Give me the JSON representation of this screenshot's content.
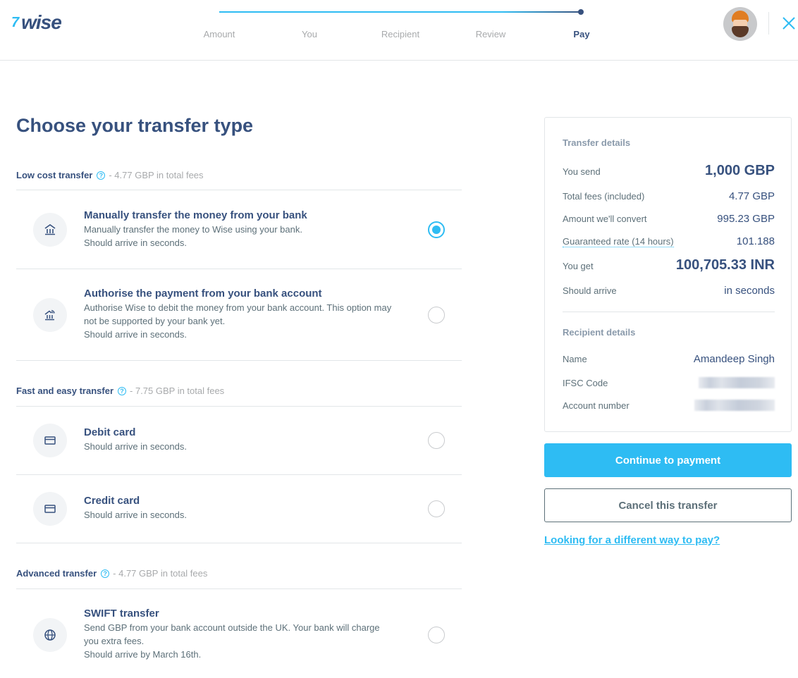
{
  "header": {
    "logo_flag": "7",
    "logo_word": "wise",
    "steps": [
      {
        "label": "Amount",
        "state": "done"
      },
      {
        "label": "You",
        "state": "done"
      },
      {
        "label": "Recipient",
        "state": "done"
      },
      {
        "label": "Review",
        "state": "done"
      },
      {
        "label": "Pay",
        "state": "active"
      }
    ],
    "avatar_icon": "user-avatar",
    "close_icon": "close-icon"
  },
  "main": {
    "title": "Choose your transfer type",
    "sections": [
      {
        "name": "Low cost transfer",
        "help": "?",
        "fee": "- 4.77 GBP in total fees",
        "options": [
          {
            "title": "Manually transfer the money from your bank",
            "desc": [
              "Manually transfer the money to Wise using your bank.",
              "Should arrive in seconds."
            ],
            "icon": "bank-icon",
            "selected": true
          },
          {
            "title": "Authorise the payment from your bank account",
            "desc": [
              "Authorise Wise to debit the money from your bank account. This option may not be supported by your bank yet.",
              "Should arrive in seconds."
            ],
            "icon": "bank-wireless-icon",
            "selected": false
          }
        ]
      },
      {
        "name": "Fast and easy transfer",
        "help": "?",
        "fee": "- 7.75 GBP in total fees",
        "options": [
          {
            "title": "Debit card",
            "desc": [
              "Should arrive in seconds."
            ],
            "icon": "card-icon",
            "selected": false
          },
          {
            "title": "Credit card",
            "desc": [
              "Should arrive in seconds."
            ],
            "icon": "card-icon",
            "selected": false
          }
        ]
      },
      {
        "name": "Advanced transfer",
        "help": "?",
        "fee": "- 4.77 GBP in total fees",
        "options": [
          {
            "title": "SWIFT transfer",
            "desc": [
              "Send GBP from your bank account outside the UK. Your bank will charge you extra fees.",
              "Should arrive by March 16th."
            ],
            "icon": "globe-icon",
            "selected": false
          }
        ]
      }
    ]
  },
  "summary": {
    "transfer_label": "Transfer details",
    "rows": [
      {
        "k": "You send",
        "v": "1,000 GBP"
      },
      {
        "k": "Total fees (included)",
        "v": "4.77 GBP"
      },
      {
        "k": "Amount we'll convert",
        "v": "995.23 GBP"
      },
      {
        "k": "Guaranteed rate (14 hours)",
        "v": "101.188"
      },
      {
        "k": "You get",
        "v": "100,705.33 INR"
      },
      {
        "k": "Should arrive",
        "v": "in seconds"
      }
    ],
    "recipient_label": "Recipient details",
    "recipient": [
      {
        "k": "Name",
        "v": "Amandeep Singh"
      },
      {
        "k": "IFSC Code",
        "v": "[redacted]"
      },
      {
        "k": "Account number",
        "v": "[redacted]"
      }
    ]
  },
  "actions": {
    "continue": "Continue to payment",
    "cancel": "Cancel this transfer",
    "alt_link": "Looking for a different way to pay?"
  },
  "colors": {
    "accent": "#2ebcf3",
    "navy": "#37517e",
    "muted": "#5d7079",
    "light": "#a8aaac"
  }
}
